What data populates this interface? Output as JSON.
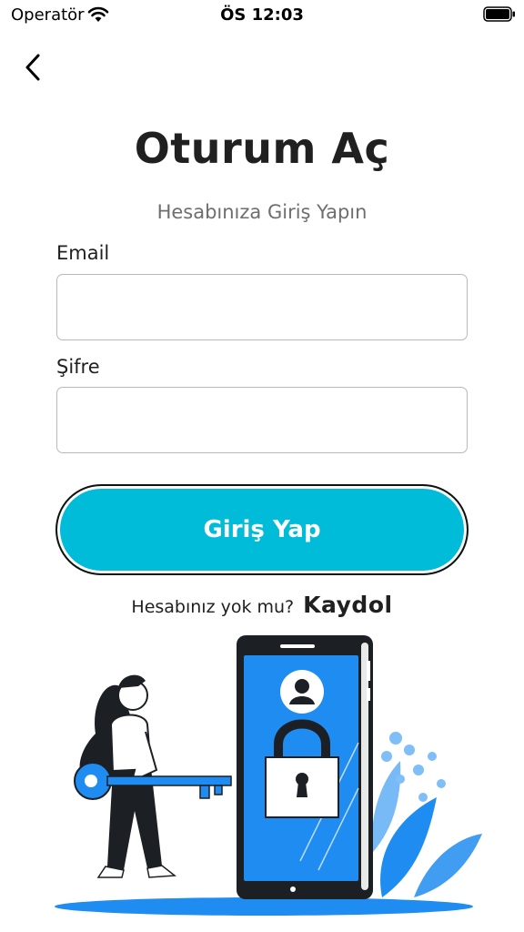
{
  "status_bar": {
    "carrier": "Operatör",
    "time": "ÖS 12:03"
  },
  "header": {
    "title": "Oturum Aç",
    "subtitle": "Hesabınıza Giriş Yapın"
  },
  "form": {
    "email_label": "Email",
    "email_value": "",
    "password_label": "Şifre",
    "password_value": "",
    "submit_label": "Giriş Yap"
  },
  "signup": {
    "prompt": "Hesabınız yok mu?",
    "link_label": "Kaydol"
  },
  "colors": {
    "accent": "#00bcd8",
    "illustration_blue": "#1e8cf0",
    "dark": "#1c1f24"
  },
  "icons": [
    "wifi-icon",
    "battery-icon",
    "chevron-left-icon",
    "lock-icon",
    "user-icon",
    "key-icon"
  ]
}
